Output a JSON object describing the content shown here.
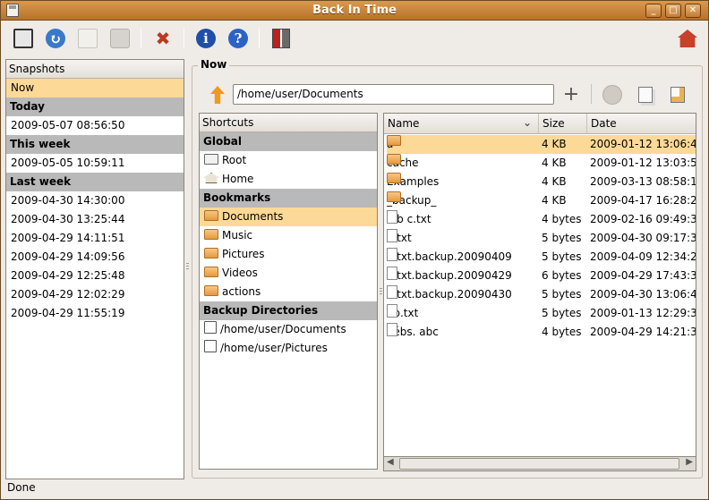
{
  "window": {
    "title": "Back In Time",
    "min": "_",
    "max": "□",
    "close": "✕"
  },
  "snapshots": {
    "header": "Snapshots",
    "items": [
      {
        "label": "Now",
        "type": "selected"
      },
      {
        "label": "Today",
        "type": "group"
      },
      {
        "label": "2009-05-07 08:56:50",
        "type": "item"
      },
      {
        "label": "This week",
        "type": "group"
      },
      {
        "label": "2009-05-05 10:59:11",
        "type": "item"
      },
      {
        "label": "Last week",
        "type": "group"
      },
      {
        "label": "2009-04-30 14:30:00",
        "type": "item"
      },
      {
        "label": "2009-04-30 13:25:44",
        "type": "item"
      },
      {
        "label": "2009-04-29 14:11:51",
        "type": "item"
      },
      {
        "label": "2009-04-29 14:09:56",
        "type": "item"
      },
      {
        "label": "2009-04-29 12:25:48",
        "type": "item"
      },
      {
        "label": "2009-04-29 12:02:29",
        "type": "item"
      },
      {
        "label": "2009-04-29 11:55:19",
        "type": "item"
      }
    ]
  },
  "main": {
    "frame_label": "Now",
    "path": "/home/user/Documents"
  },
  "shortcuts": {
    "header": "Shortcuts",
    "rows": [
      {
        "label": "Global",
        "type": "group"
      },
      {
        "label": "Root",
        "type": "drive"
      },
      {
        "label": "Home",
        "type": "home"
      },
      {
        "label": "Bookmarks",
        "type": "group"
      },
      {
        "label": "Documents",
        "type": "folder-selected"
      },
      {
        "label": "Music",
        "type": "folder"
      },
      {
        "label": "Pictures",
        "type": "folder"
      },
      {
        "label": "Videos",
        "type": "folder"
      },
      {
        "label": "actions",
        "type": "folder"
      },
      {
        "label": "Backup Directories",
        "type": "group"
      },
      {
        "label": "/home/user/Documents",
        "type": "floppy"
      },
      {
        "label": "/home/user/Pictures",
        "type": "floppy"
      }
    ]
  },
  "files": {
    "columns": {
      "name": "Name",
      "size": "Size",
      "date": "Date"
    },
    "rows": [
      {
        "name": "a",
        "size": "4 KB",
        "date": "2009-01-12 13:06:4",
        "kind": "folder",
        "selected": true
      },
      {
        "name": "cache",
        "size": "4 KB",
        "date": "2009-01-12 13:03:5",
        "kind": "folder"
      },
      {
        "name": "Examples",
        "size": "4 KB",
        "date": "2009-03-13 08:58:1",
        "kind": "folder"
      },
      {
        "name": "_backup_",
        "size": "4 KB",
        "date": "2009-04-17 16:28:2",
        "kind": "folder"
      },
      {
        "name": "a b c.txt",
        "size": "4 bytes",
        "date": "2009-02-16 09:49:3",
        "kind": "doc"
      },
      {
        "name": "a.txt",
        "size": "5 bytes",
        "date": "2009-04-30 09:17:3",
        "kind": "doc"
      },
      {
        "name": "a.txt.backup.20090409",
        "size": "5 bytes",
        "date": "2009-04-09 12:34:2",
        "kind": "doc"
      },
      {
        "name": "a.txt.backup.20090429",
        "size": "6 bytes",
        "date": "2009-04-29 17:43:3",
        "kind": "doc"
      },
      {
        "name": "a.txt.backup.20090430",
        "size": "5 bytes",
        "date": "2009-04-30 13:06:4",
        "kind": "doc"
      },
      {
        "name": "ab.txt",
        "size": "5 bytes",
        "date": "2009-01-13 12:29:3",
        "kind": "doc"
      },
      {
        "name": "éébs. abc",
        "size": "4 bytes",
        "date": "2009-04-29 14:21:3",
        "kind": "doc"
      }
    ]
  },
  "status": "Done"
}
